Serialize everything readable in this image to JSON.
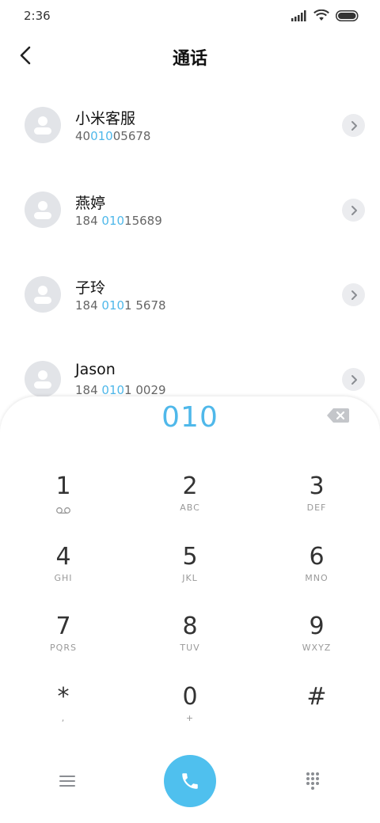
{
  "status_bar": {
    "time": "2:36"
  },
  "header": {
    "title": "通话"
  },
  "contacts": [
    {
      "name": "小米客服",
      "number_pre": "40",
      "number_match": "010",
      "number_post": "05678"
    },
    {
      "name": "燕婷",
      "number_pre": "184 ",
      "number_match": "010",
      "number_post": "15689"
    },
    {
      "name": "子玲",
      "number_pre": "184 ",
      "number_match": "010",
      "number_post": "1 5678"
    },
    {
      "name": "Jason",
      "number_pre": "184 ",
      "number_match": "010",
      "number_post": "1 0029"
    }
  ],
  "dialpad": {
    "display": "010",
    "keys": [
      {
        "digit": "1",
        "letters": ""
      },
      {
        "digit": "2",
        "letters": "ABC"
      },
      {
        "digit": "3",
        "letters": "DEF"
      },
      {
        "digit": "4",
        "letters": "GHI"
      },
      {
        "digit": "5",
        "letters": "JKL"
      },
      {
        "digit": "6",
        "letters": "MNO"
      },
      {
        "digit": "7",
        "letters": "PQRS"
      },
      {
        "digit": "8",
        "letters": "TUV"
      },
      {
        "digit": "9",
        "letters": "WXYZ"
      },
      {
        "digit": "*",
        "letters": ","
      },
      {
        "digit": "0",
        "letters": "+"
      },
      {
        "digit": "#",
        "letters": ""
      }
    ]
  },
  "icons": {
    "back": "chevron-left-icon",
    "row_action": "chevron-right-icon",
    "backspace": "backspace-icon",
    "voicemail": "voicemail-icon",
    "menu": "menu-icon",
    "call": "phone-icon",
    "keypad": "keypad-icon"
  },
  "colors": {
    "accent": "#4fb8ea",
    "call_button": "#4fc0ee",
    "avatar_bg": "#e2e4e8"
  }
}
